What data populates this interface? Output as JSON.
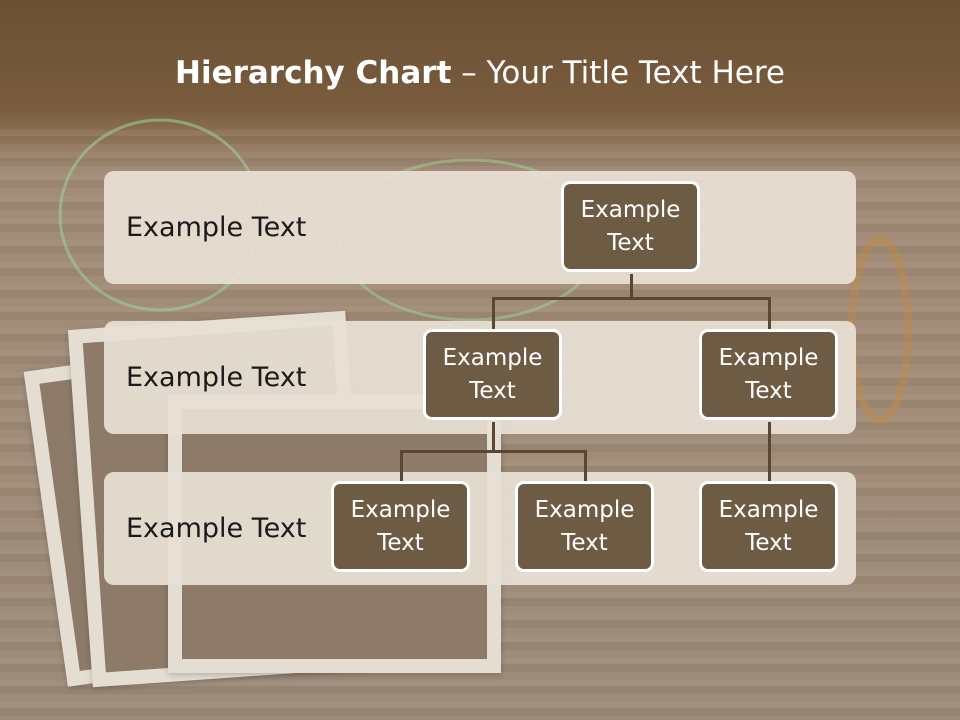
{
  "title": {
    "bold": "Hierarchy Chart",
    "rest": " – Your Title Text Here"
  },
  "levels": [
    {
      "label": "Example Text"
    },
    {
      "label": "Example Text"
    },
    {
      "label": "Example Text"
    }
  ],
  "nodes": {
    "root": "Example Text",
    "left": "Example Text",
    "right": "Example Text",
    "left_child_1": "Example Text",
    "left_child_2": "Example Text",
    "right_child_1": "Example Text"
  },
  "colors": {
    "node_fill": "#6e5b44",
    "band_fill": "#e8e0d5",
    "header_brown": "#6b5034"
  }
}
